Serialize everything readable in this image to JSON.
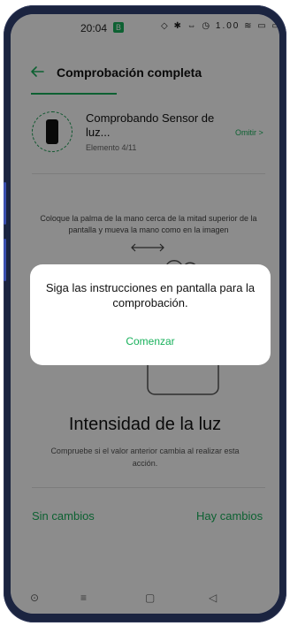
{
  "status_bar": {
    "time": "20:04",
    "badge": "B",
    "icons": "◇ ✱ ⇔ ◷ 1.00 ≋ ▭ ▭"
  },
  "header": {
    "title": "Comprobación completa"
  },
  "item": {
    "title": "Comprobando Sensor de luz...",
    "subtitle": "Elemento 4/11",
    "skip": "Omitir >"
  },
  "instruction": {
    "text": "Coloque la palma de la mano cerca de la mitad superior de la pantalla y mueva la mano como en la imagen"
  },
  "result": {
    "title": "Intensidad de la luz",
    "text": "Compruebe si el valor anterior cambia al realizar esta acción."
  },
  "buttons": {
    "no_change": "Sin cambios",
    "has_change": "Hay cambios"
  },
  "dialog": {
    "message": "Siga las instrucciones en pantalla para la comprobación.",
    "button": "Comenzar"
  },
  "nav": {
    "home": "⊙",
    "menu": "≡",
    "square": "▢",
    "back": "◁"
  },
  "colors": {
    "accent": "#18b15b",
    "overlay": "rgba(0,0,0,0.45)"
  }
}
